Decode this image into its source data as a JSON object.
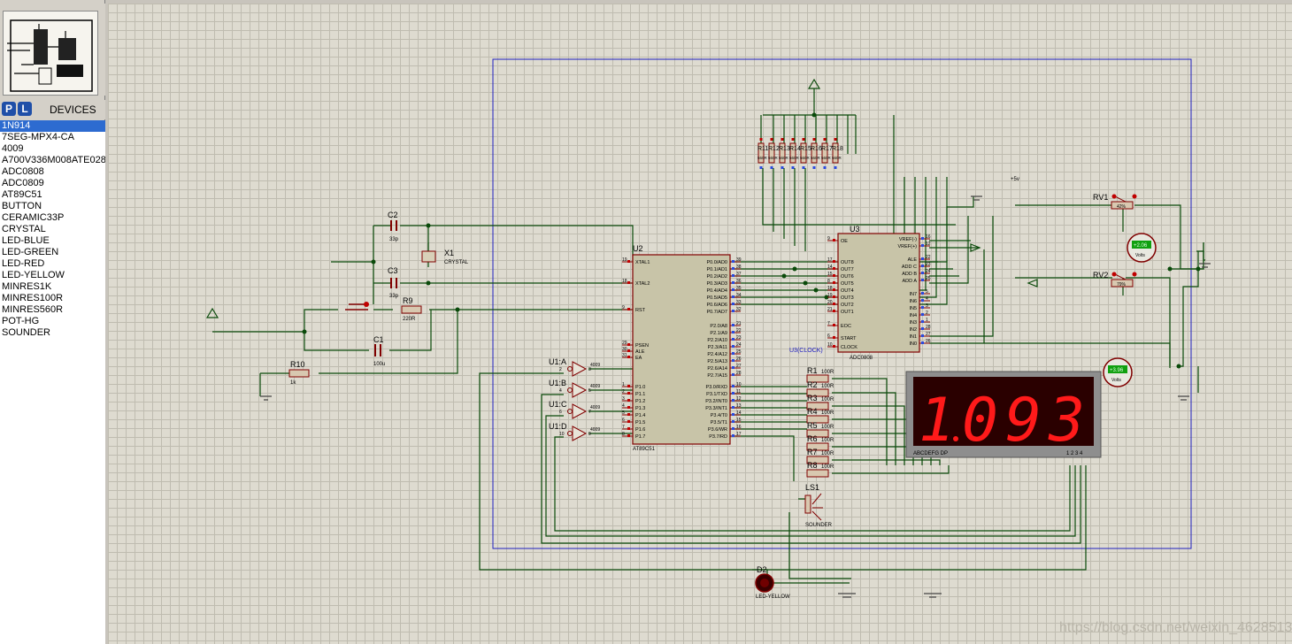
{
  "sidebar": {
    "p_button": "P",
    "l_button": "L",
    "devices_title": "DEVICES",
    "devices": [
      "1N914",
      "7SEG-MPX4-CA",
      "4009",
      "A700V336M008ATE028",
      "ADC0808",
      "ADC0809",
      "AT89C51",
      "BUTTON",
      "CERAMIC33P",
      "CRYSTAL",
      "LED-BLUE",
      "LED-GREEN",
      "LED-RED",
      "LED-YELLOW",
      "MINRES1K",
      "MINRES100R",
      "MINRES560R",
      "POT-HG",
      "SOUNDER"
    ],
    "selected_index": 0
  },
  "schematic": {
    "c2": {
      "ref": "C2",
      "value": "33p"
    },
    "c3": {
      "ref": "C3",
      "value": "33p"
    },
    "x1": {
      "ref": "X1",
      "value": "CRYSTAL"
    },
    "r9": {
      "ref": "R9",
      "value": "220R"
    },
    "c1": {
      "ref": "C1",
      "value": "100u"
    },
    "r10": {
      "ref": "R10",
      "value": "1k"
    },
    "u2": {
      "ref": "U2",
      "part": "AT89C51"
    },
    "u3": {
      "ref": "U3",
      "part": "ADC0808"
    },
    "u1_gates": [
      "U1:A",
      "U1:B",
      "U1:C",
      "U1:D"
    ],
    "gate_part": "4009",
    "seg_resistors": [
      {
        "ref": "R1",
        "value": "100R"
      },
      {
        "ref": "R2",
        "value": "100R"
      },
      {
        "ref": "R3",
        "value": "100R"
      },
      {
        "ref": "R4",
        "value": "100R"
      },
      {
        "ref": "R5",
        "value": "100R"
      },
      {
        "ref": "R6",
        "value": "100R"
      },
      {
        "ref": "R7",
        "value": "100R"
      },
      {
        "ref": "R8",
        "value": "100R"
      }
    ],
    "pullup_refs": [
      "R11",
      "R12",
      "R13",
      "R14",
      "R15",
      "R16",
      "R17",
      "R18"
    ],
    "pullup_value": "560R",
    "rv1": {
      "ref": "RV1",
      "setting": "42%"
    },
    "rv2": {
      "ref": "RV2",
      "setting": "79%"
    },
    "volt1": {
      "reading": "+2.06",
      "unit": "Volts"
    },
    "volt2": {
      "reading": "+3.96",
      "unit": "Volts"
    },
    "supply": "+5v",
    "ls1": {
      "ref": "LS1",
      "part": "SOUNDER"
    },
    "d2": {
      "ref": "D2",
      "part": "LED-YELLOW"
    },
    "display": {
      "digits": [
        "1",
        "0",
        "9",
        "3"
      ],
      "decimal_after_index": 0,
      "seg_label": "ABCDEFG  DP",
      "com_label": "1 2 3 4"
    },
    "clock_label": "U3(CLOCK)",
    "u2_left_pins": [
      {
        "num": "19",
        "name": "XTAL1"
      },
      {
        "num": "18",
        "name": "XTAL2"
      },
      {
        "num": "9",
        "name": "RST"
      },
      {
        "num": "29",
        "name": "PSEN"
      },
      {
        "num": "30",
        "name": "ALE"
      },
      {
        "num": "31",
        "name": "EA"
      },
      {
        "num": "1",
        "name": "P1.0"
      },
      {
        "num": "2",
        "name": "P1.1"
      },
      {
        "num": "3",
        "name": "P1.2"
      },
      {
        "num": "4",
        "name": "P1.3"
      },
      {
        "num": "5",
        "name": "P1.4"
      },
      {
        "num": "6",
        "name": "P1.5"
      },
      {
        "num": "7",
        "name": "P1.6"
      },
      {
        "num": "8",
        "name": "P1.7"
      }
    ],
    "u2_right_pins": [
      {
        "num": "39",
        "name": "P0.0/AD0"
      },
      {
        "num": "38",
        "name": "P0.1/AD1"
      },
      {
        "num": "37",
        "name": "P0.2/AD2"
      },
      {
        "num": "36",
        "name": "P0.3/AD3"
      },
      {
        "num": "35",
        "name": "P0.4/AD4"
      },
      {
        "num": "34",
        "name": "P0.5/AD5"
      },
      {
        "num": "33",
        "name": "P0.6/AD6"
      },
      {
        "num": "32",
        "name": "P0.7/AD7"
      },
      {
        "num": "21",
        "name": "P2.0/A8"
      },
      {
        "num": "22",
        "name": "P2.1/A9"
      },
      {
        "num": "23",
        "name": "P2.2/A10"
      },
      {
        "num": "24",
        "name": "P2.3/A11"
      },
      {
        "num": "25",
        "name": "P2.4/A12"
      },
      {
        "num": "26",
        "name": "P2.5/A13"
      },
      {
        "num": "27",
        "name": "P2.6/A14"
      },
      {
        "num": "28",
        "name": "P2.7/A15"
      },
      {
        "num": "10",
        "name": "P3.0/RXD"
      },
      {
        "num": "11",
        "name": "P3.1/TXD"
      },
      {
        "num": "12",
        "name": "P3.2/INT0"
      },
      {
        "num": "13",
        "name": "P3.3/INT1"
      },
      {
        "num": "14",
        "name": "P3.4/T0"
      },
      {
        "num": "15",
        "name": "P3.5/T1"
      },
      {
        "num": "16",
        "name": "P3.6/WR"
      },
      {
        "num": "17",
        "name": "P3.7/RD"
      }
    ],
    "u3_left_pins": [
      {
        "num": "9",
        "name": "OE"
      },
      {
        "num": "17",
        "name": "OUT8"
      },
      {
        "num": "14",
        "name": "OUT7"
      },
      {
        "num": "15",
        "name": "OUT6"
      },
      {
        "num": "8",
        "name": "OUT5"
      },
      {
        "num": "18",
        "name": "OUT4"
      },
      {
        "num": "19",
        "name": "OUT3"
      },
      {
        "num": "20",
        "name": "OUT2"
      },
      {
        "num": "21",
        "name": "OUT1"
      },
      {
        "num": "7",
        "name": "EOC"
      },
      {
        "num": "6",
        "name": "START"
      },
      {
        "num": "10",
        "name": "CLOCK"
      }
    ],
    "u3_right_pins": [
      {
        "num": "16",
        "name": "VREF(-)"
      },
      {
        "num": "12",
        "name": "VREF(+)"
      },
      {
        "num": "22",
        "name": "ALE"
      },
      {
        "num": "23",
        "name": "ADD C"
      },
      {
        "num": "24",
        "name": "ADD B"
      },
      {
        "num": "25",
        "name": "ADD A"
      },
      {
        "num": "5",
        "name": "IN7"
      },
      {
        "num": "4",
        "name": "IN6"
      },
      {
        "num": "3",
        "name": "IN5"
      },
      {
        "num": "2",
        "name": "IN4"
      },
      {
        "num": "1",
        "name": "IN3"
      },
      {
        "num": "28",
        "name": "IN2"
      },
      {
        "num": "27",
        "name": "IN1"
      },
      {
        "num": "26",
        "name": "IN0"
      }
    ]
  },
  "watermark": "https://blog.csdn.net/weixin_46285130"
}
